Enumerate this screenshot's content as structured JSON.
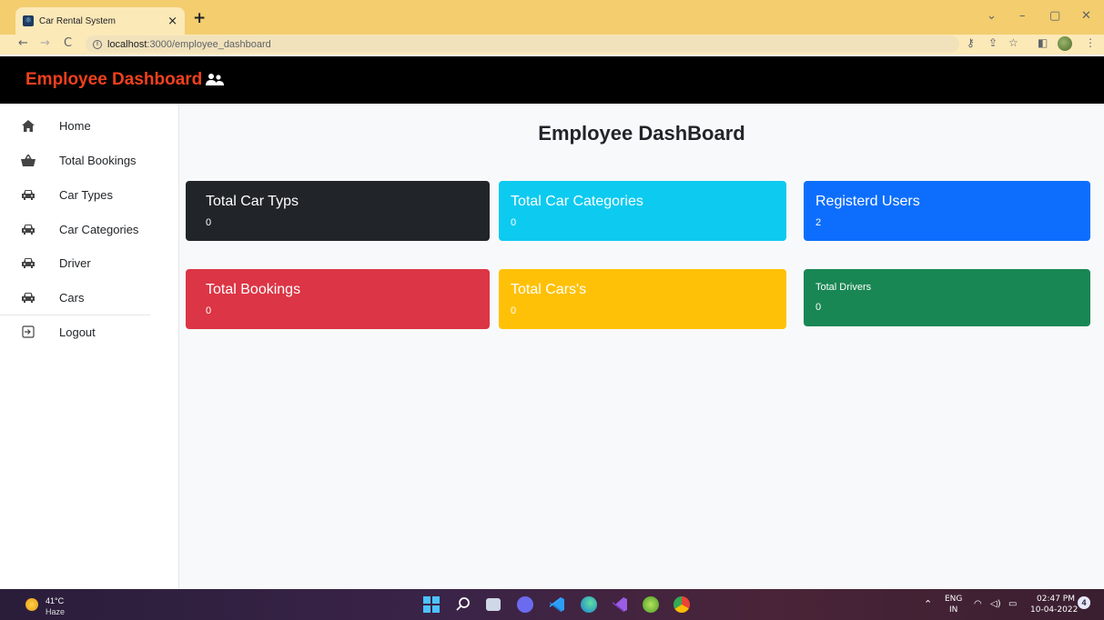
{
  "browser": {
    "tab_title": "Car Rental System",
    "url_host": "localhost",
    "url_path": ":3000/employee_dashboard",
    "new_tab": "+",
    "close_tab": "×"
  },
  "header": {
    "brand": "Employee Dashboard"
  },
  "sidebar": {
    "items": [
      {
        "label": "Home",
        "icon": "home-icon"
      },
      {
        "label": "Total Bookings",
        "icon": "basket-icon"
      },
      {
        "label": "Car Types",
        "icon": "car-icon"
      },
      {
        "label": "Car Categories",
        "icon": "car-icon"
      },
      {
        "label": "Driver",
        "icon": "car-icon"
      },
      {
        "label": "Cars",
        "icon": "car-icon"
      },
      {
        "label": "Logout",
        "icon": "logout-icon"
      }
    ]
  },
  "main": {
    "title": "Employee DashBoard",
    "cards": [
      {
        "title": "Total Car Typs",
        "value": "0",
        "color": "#212529"
      },
      {
        "title": "Total Car Categories",
        "value": "0",
        "color": "#0dcaf0"
      },
      {
        "title": "Registerd Users",
        "value": "2",
        "color": "#0d6efd"
      },
      {
        "title": "Total Bookings",
        "value": "0",
        "color": "#dc3545"
      },
      {
        "title": "Total Cars's",
        "value": "0",
        "color": "#ffc107"
      },
      {
        "title": "Total Drivers",
        "value": "0",
        "color": "#198754"
      }
    ]
  },
  "taskbar": {
    "temp": "41°C",
    "weather": "Haze",
    "lang": "ENG",
    "region": "IN",
    "time": "02:47 PM",
    "date": "10-04-2022",
    "notifications": "4"
  }
}
